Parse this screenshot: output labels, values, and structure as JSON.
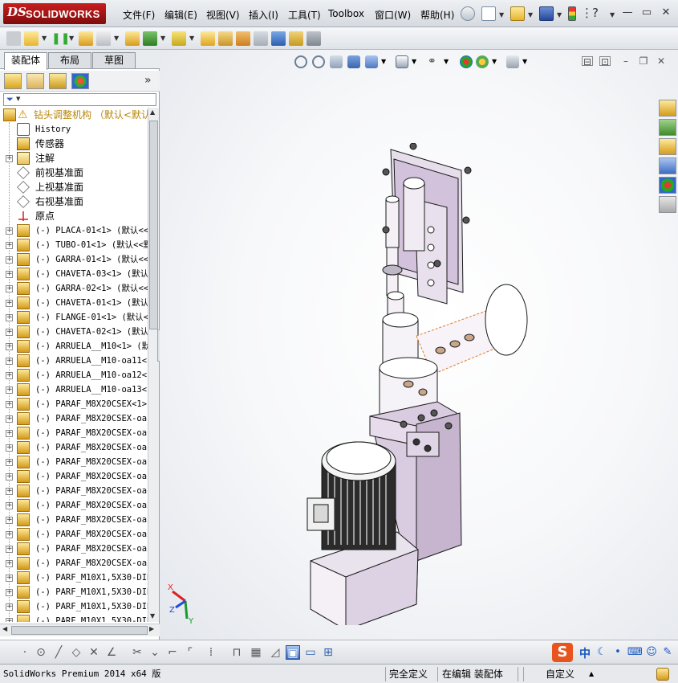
{
  "app": {
    "brand_ds": "DS",
    "brand_name": "SOLIDWORKS"
  },
  "menu": [
    "文件(F)",
    "编辑(E)",
    "视图(V)",
    "插入(I)",
    "工具(T)",
    "Toolbox",
    "窗口(W)",
    "帮助(H)"
  ],
  "window_controls": {
    "minimize": "—",
    "restore": "▭",
    "close": "✕"
  },
  "panel": {
    "tabs": [
      "装配体",
      "布局",
      "草图"
    ],
    "active_tab": "装配体",
    "expand_arrow": "»",
    "root": {
      "label": "钻头调整机构  （默认<默认_显"
    },
    "nodes": [
      {
        "label": "History",
        "mono": true,
        "expand": "",
        "icon": "history"
      },
      {
        "label": "传感器",
        "mono": false,
        "expand": "",
        "icon": "sensor"
      },
      {
        "label": "注解",
        "mono": false,
        "expand": "+",
        "icon": "annotation"
      },
      {
        "label": "前视基准面",
        "mono": false,
        "expand": "",
        "icon": "plane"
      },
      {
        "label": "上视基准面",
        "mono": false,
        "expand": "",
        "icon": "plane"
      },
      {
        "label": "右视基准面",
        "mono": false,
        "expand": "",
        "icon": "plane"
      },
      {
        "label": "原点",
        "mono": false,
        "expand": "",
        "icon": "origin"
      },
      {
        "label": "(-) PLACA-01<1> (默认<<",
        "mono": true,
        "expand": "+",
        "icon": "part"
      },
      {
        "label": "(-) TUBO-01<1> (默认<<默",
        "mono": true,
        "expand": "+",
        "icon": "part"
      },
      {
        "label": "(-) GARRA-01<1> (默认<<",
        "mono": true,
        "expand": "+",
        "icon": "part"
      },
      {
        "label": "(-) CHAVETA-03<1> (默认",
        "mono": true,
        "expand": "+",
        "icon": "part"
      },
      {
        "label": "(-) GARRA-02<1> (默认<<",
        "mono": true,
        "expand": "+",
        "icon": "part"
      },
      {
        "label": "(-) CHAVETA-01<1> (默认",
        "mono": true,
        "expand": "+",
        "icon": "part"
      },
      {
        "label": "(-) FLANGE-01<1> (默认<",
        "mono": true,
        "expand": "+",
        "icon": "part"
      },
      {
        "label": "(-) CHAVETA-02<1> (默认",
        "mono": true,
        "expand": "+",
        "icon": "part"
      },
      {
        "label": "(-) ARRUELA__M10<1> (默",
        "mono": true,
        "expand": "+",
        "icon": "part"
      },
      {
        "label": "(-) ARRUELA__M10-oa11<1",
        "mono": true,
        "expand": "+",
        "icon": "part"
      },
      {
        "label": "(-) ARRUELA__M10-oa12<1",
        "mono": true,
        "expand": "+",
        "icon": "part"
      },
      {
        "label": "(-) ARRUELA__M10-oa13<1",
        "mono": true,
        "expand": "+",
        "icon": "part"
      },
      {
        "label": "(-) PARAF_M8X20CSEX<1>",
        "mono": true,
        "expand": "+",
        "icon": "part"
      },
      {
        "label": "(-) PARAF_M8X20CSEX-oa1",
        "mono": true,
        "expand": "+",
        "icon": "part"
      },
      {
        "label": "(-) PARAF_M8X20CSEX-oa1",
        "mono": true,
        "expand": "+",
        "icon": "part"
      },
      {
        "label": "(-) PARAF_M8X20CSEX-oa1",
        "mono": true,
        "expand": "+",
        "icon": "part"
      },
      {
        "label": "(-) PARAF_M8X20CSEX-oa1",
        "mono": true,
        "expand": "+",
        "icon": "part"
      },
      {
        "label": "(-) PARAF_M8X20CSEX-oa1",
        "mono": true,
        "expand": "+",
        "icon": "part"
      },
      {
        "label": "(-) PARAF_M8X20CSEX-oa1",
        "mono": true,
        "expand": "+",
        "icon": "part"
      },
      {
        "label": "(-) PARAF_M8X20CSEX-oa2",
        "mono": true,
        "expand": "+",
        "icon": "part"
      },
      {
        "label": "(-) PARAF_M8X20CSEX-oa2",
        "mono": true,
        "expand": "+",
        "icon": "part"
      },
      {
        "label": "(-) PARAF_M8X20CSEX-oa2",
        "mono": true,
        "expand": "+",
        "icon": "part"
      },
      {
        "label": "(-) PARAF_M8X20CSEX-oa2",
        "mono": true,
        "expand": "+",
        "icon": "part"
      },
      {
        "label": "(-) PARAF_M8X20CSEX-oa2",
        "mono": true,
        "expand": "+",
        "icon": "part"
      },
      {
        "label": "(-) PARF_M10X1,5X30-DIN",
        "mono": true,
        "expand": "+",
        "icon": "part"
      },
      {
        "label": "(-) PARF_M10X1,5X30-DIN",
        "mono": true,
        "expand": "+",
        "icon": "part"
      },
      {
        "label": "(-) PARF_M10X1,5X30-DIN",
        "mono": true,
        "expand": "+",
        "icon": "part"
      },
      {
        "label": "(-) PARF_M10X1,5X30-DIN",
        "mono": true,
        "expand": "+",
        "icon": "part"
      }
    ]
  },
  "triad": {
    "x": "X",
    "y": "Y",
    "z": "Z"
  },
  "ime": {
    "logo": "S",
    "mode": "中"
  },
  "status": {
    "product": "SolidWorks Premium 2014 x64 版",
    "definition": "完全定义",
    "editing": "在编辑 装配体",
    "custom": "自定义",
    "custom_arrow": "▲"
  },
  "colors": {
    "model_fill": "#d9cbe0",
    "model_accent": "#f5f0f7",
    "selection_edge": "#e07b1a",
    "brand": "#b01616"
  }
}
